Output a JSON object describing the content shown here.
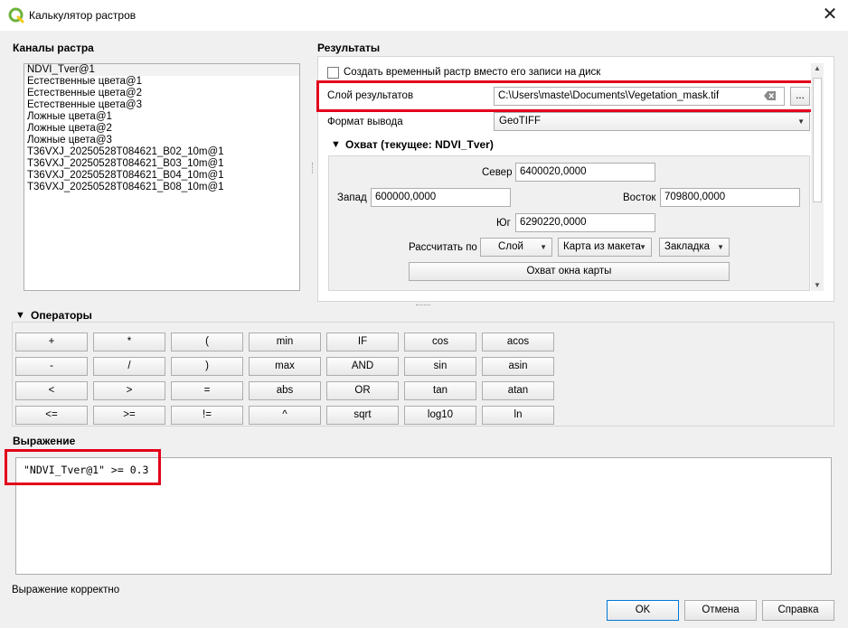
{
  "window": {
    "title": "Калькулятор растров",
    "close_glyph": "✕"
  },
  "raster_bands": {
    "label": "Каналы растра",
    "items": [
      "NDVI_Tver@1",
      "Естественные цвета@1",
      "Естественные цвета@2",
      "Естественные цвета@3",
      "Ложные цвета@1",
      "Ложные цвета@2",
      "Ложные цвета@3",
      "T36VXJ_20250528T084621_B02_10m@1",
      "T36VXJ_20250528T084621_B03_10m@1",
      "T36VXJ_20250528T084621_B04_10m@1",
      "T36VXJ_20250528T084621_B08_10m@1"
    ]
  },
  "results": {
    "label": "Результаты",
    "temp_checkbox_label": "Создать временный растр вместо его записи на диск",
    "output_layer_label": "Слой результатов",
    "output_layer_value": "C:\\Users\\maste\\Documents\\Vegetation_mask.tif",
    "browse_label": "...",
    "format_label": "Формат вывода",
    "format_value": "GeoTIFF",
    "extent": {
      "label": "Охват (текущее: NDVI_Tver)",
      "north_label": "Север",
      "north_value": "6400020,0000",
      "west_label": "Запад",
      "west_value": "600000,0000",
      "east_label": "Восток",
      "east_value": "709800,0000",
      "south_label": "Юг",
      "south_value": "6290220,0000",
      "calc_label": "Рассчитать по",
      "layer_btn": "Слой",
      "layout_btn": "Карта из макета",
      "bookmark_btn": "Закладка",
      "canvas_btn": "Охват окна карты"
    }
  },
  "operators": {
    "label": "Операторы",
    "rows": [
      [
        "+",
        "*",
        "(",
        "min",
        "IF",
        "cos",
        "acos"
      ],
      [
        "-",
        "/",
        ")",
        "max",
        "AND",
        "sin",
        "asin"
      ],
      [
        "<",
        ">",
        "=",
        "abs",
        "OR",
        "tan",
        "atan"
      ],
      [
        "<=",
        ">=",
        "!=",
        "^",
        "sqrt",
        "log10",
        "ln"
      ]
    ]
  },
  "expression": {
    "label": "Выражение",
    "value": "\"NDVI_Tver@1\" >= 0.3",
    "status": "Выражение корректно"
  },
  "buttons": {
    "ok": "OK",
    "cancel": "Отмена",
    "help": "Справка"
  },
  "colors": {
    "highlight": "#e3001b",
    "qgis_green": "#6fb23e"
  }
}
